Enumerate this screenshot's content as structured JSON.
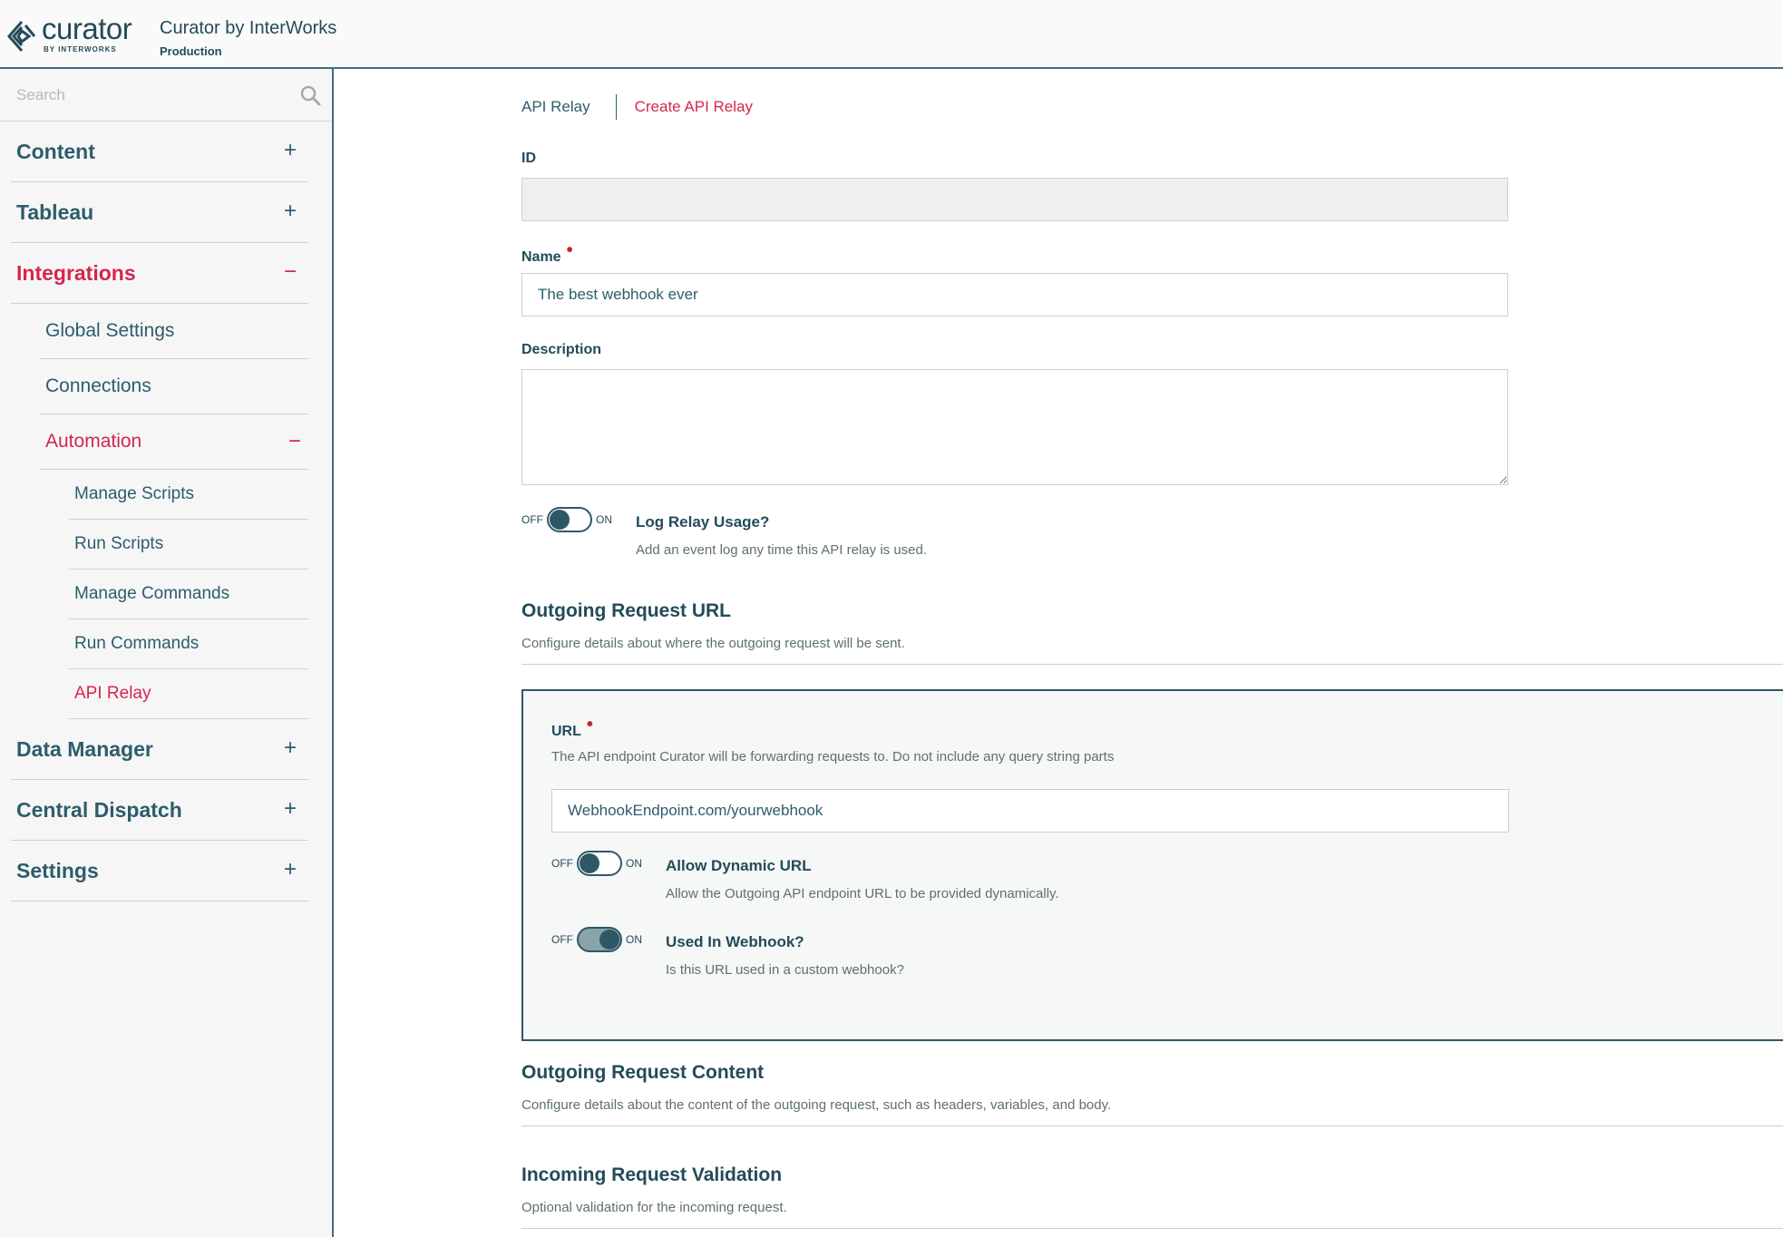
{
  "header": {
    "logo_word": "curator",
    "logo_sub": "BY INTERWORKS",
    "app_title": "Curator by InterWorks",
    "environment": "Production"
  },
  "sidebar": {
    "search_placeholder": "Search",
    "nav": {
      "content": "Content",
      "tableau": "Tableau",
      "integrations": "Integrations",
      "global_settings": "Global Settings",
      "connections": "Connections",
      "automation": "Automation",
      "manage_scripts": "Manage Scripts",
      "run_scripts": "Run Scripts",
      "manage_commands": "Manage Commands",
      "run_commands": "Run Commands",
      "api_relay": "API Relay",
      "data_manager": "Data Manager",
      "central_dispatch": "Central Dispatch",
      "settings": "Settings"
    },
    "expand_symbol": "+",
    "collapse_symbol": "−"
  },
  "breadcrumb": {
    "parent": "API Relay",
    "current": "Create API Relay"
  },
  "form": {
    "id_label": "ID",
    "id_value": "",
    "name_label": "Name",
    "name_value": "The best webhook ever",
    "description_label": "Description",
    "description_value": "",
    "required_marker": "•",
    "switch_off": "OFF",
    "switch_on": "ON",
    "log_usage": {
      "title": "Log Relay Usage?",
      "desc": "Add an event log any time this API relay is used.",
      "enabled": false
    }
  },
  "outgoing_url": {
    "title": "Outgoing Request URL",
    "desc": "Configure details about where the outgoing request will be sent.",
    "url_label": "URL",
    "url_desc": "The API endpoint Curator will be forwarding requests to. Do not include any query string parts",
    "url_value": "WebhookEndpoint.com/yourwebhook",
    "dynamic": {
      "title": "Allow Dynamic URL",
      "desc": "Allow the Outgoing API endpoint URL to be provided dynamically.",
      "enabled": false
    },
    "webhook": {
      "title": "Used In Webhook?",
      "desc": "Is this URL used in a custom webhook?",
      "enabled": true
    }
  },
  "outgoing_content": {
    "title": "Outgoing Request Content",
    "desc": "Configure details about the content of the outgoing request, such as headers, variables, and body."
  },
  "incoming_validation": {
    "title": "Incoming Request Validation",
    "desc": "Optional validation for the incoming request."
  },
  "colors": {
    "primary": "#2c5d6c",
    "accent": "#d4264e",
    "required": "#c0262e"
  }
}
